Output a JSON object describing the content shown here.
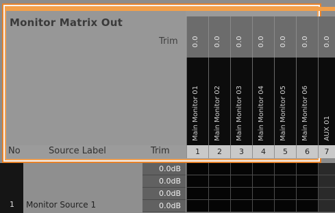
{
  "panel": {
    "title": "Monitor Matrix Out",
    "trim_label": "Trim"
  },
  "header_row": {
    "no_label": "No",
    "source_label": "Source Label",
    "trim_label": "Trim"
  },
  "columns": [
    {
      "number": "1",
      "trim": "0.0",
      "name": "Main Monitor 01"
    },
    {
      "number": "2",
      "trim": "0.0",
      "name": "Main Monitor 02"
    },
    {
      "number": "3",
      "trim": "0.0",
      "name": "Main Monitor 03"
    },
    {
      "number": "4",
      "trim": "0.0",
      "name": "Main Monitor 04"
    },
    {
      "number": "5",
      "trim": "0.0",
      "name": "Main Monitor 05"
    },
    {
      "number": "6",
      "trim": "0.0",
      "name": "Main Monitor 06"
    },
    {
      "number": "7",
      "trim": "0.0",
      "name": "AUX 01"
    }
  ],
  "rows": [
    {
      "number": "1",
      "label": "Monitor Source 1",
      "trims": [
        "0.0dB",
        "0.0dB",
        "0.0dB",
        "0.0dB"
      ]
    }
  ],
  "colors": {
    "accent_orange": "#e98227",
    "frame_orange_light": "#f3a04a",
    "dark_cell": "#0c0c0c",
    "trim_cell": "#616161"
  }
}
